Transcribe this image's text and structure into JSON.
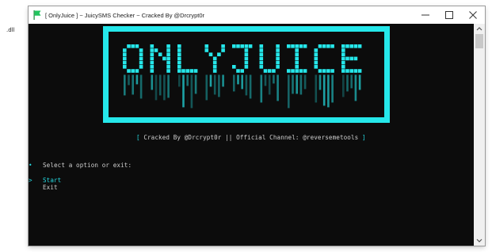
{
  "desktop": {
    "label": ".dll"
  },
  "window": {
    "title": "[ OnlyJuice ] ~ JuicySMS Checker ~ Cracked By @Drcrypt0r",
    "controls": {
      "minimize": "minimize-icon",
      "maximize": "maximize-icon",
      "close": "close-icon"
    }
  },
  "console": {
    "banner_text": "ONLYJUICE",
    "credit": {
      "open": "[",
      "text": " Cracked By @Drcrypt0r || Official Channel: @reversemetools ",
      "close": "]"
    },
    "prompt": {
      "bullet": "•",
      "text": "Select a option or exit:"
    },
    "menu": {
      "cursor": ">",
      "options": [
        "Start",
        "Exit"
      ],
      "selected_index": 0
    }
  },
  "colors": {
    "accent": "#25e7ea",
    "console_bg": "#0c0c0c",
    "text": "#cfcfcf"
  }
}
